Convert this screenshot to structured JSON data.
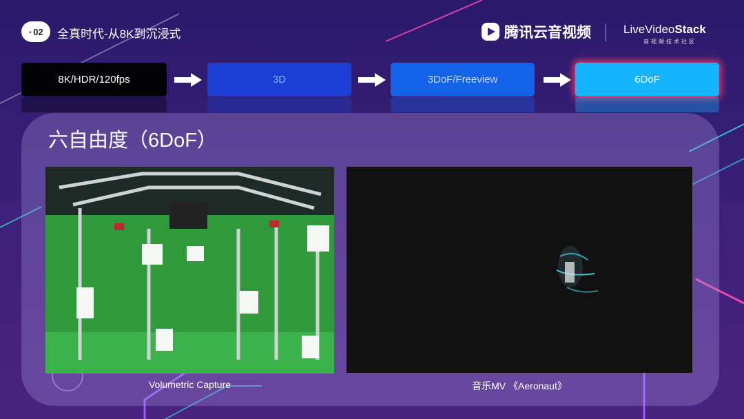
{
  "header": {
    "badge_number": "02",
    "title": "全真时代-从8K到沉浸式",
    "brand_name": "腾讯云音视频",
    "partner_logo_prefix": "LiveVideo",
    "partner_logo_suffix": "Stack",
    "partner_logo_sub": "音视频技术社区"
  },
  "steps": [
    {
      "label": "8K/HDR/120fps"
    },
    {
      "label": "3D"
    },
    {
      "label": "3DoF/Freeview"
    },
    {
      "label": "6DoF"
    }
  ],
  "panel": {
    "title": "六自由度（6DoF）",
    "left_caption": "Volumetric Capture",
    "right_caption": "音乐MV 《Aeronaut》"
  },
  "colors": {
    "background": "#3a1f7a",
    "step_active": "#14b4ff",
    "step_active_glow": "#e33a6a"
  }
}
